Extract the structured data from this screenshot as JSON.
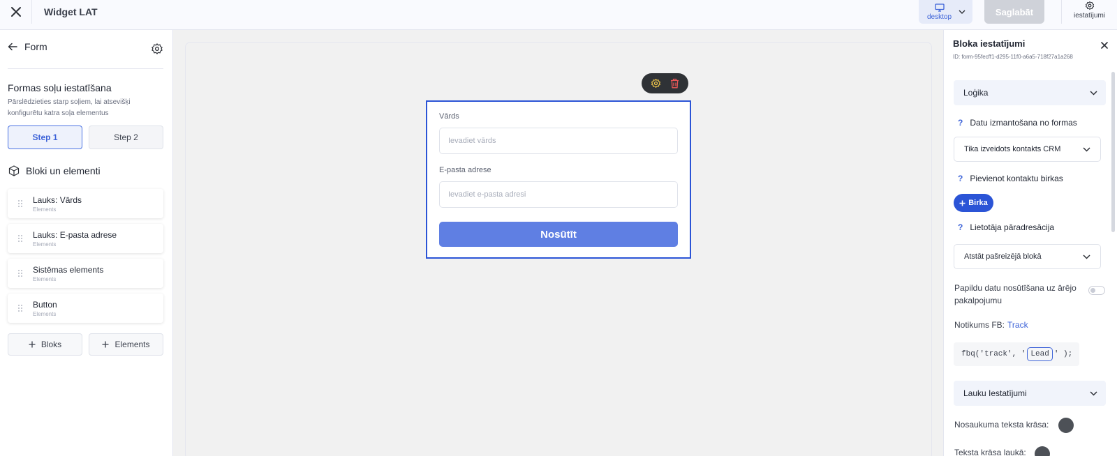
{
  "topbar": {
    "title": "Widget LAT",
    "device_label": "desktop",
    "save_label": "Saglabāt",
    "settings_label": "iestatījumi"
  },
  "left": {
    "back_label": "Form",
    "steps_title": "Formas soļu iestatīšana",
    "steps_desc": "Pārslēdzieties starp soļiem, lai atsevišķi konfigurētu katra soļa elementus",
    "steps": [
      "Step 1",
      "Step 2"
    ],
    "blocks_title": "Bloki un elementi",
    "items": [
      {
        "title": "Lauks: Vārds",
        "sub": "Elements"
      },
      {
        "title": "Lauks: E-pasta adrese",
        "sub": "Elements"
      },
      {
        "title": "Sistēmas elements",
        "sub": "Elements"
      },
      {
        "title": "Button",
        "sub": "Elements"
      }
    ],
    "add_block": "Bloks",
    "add_element": "Elements"
  },
  "form": {
    "name_label": "Vārds",
    "name_placeholder": "Ievadiet vārds",
    "email_label": "E-pasta adrese",
    "email_placeholder": "Ievadiet e-pasta adresi",
    "submit_label": "Nosūtīt"
  },
  "right": {
    "title": "Bloka iestatījumi",
    "id_text": "ID: form-95fecff1-d295-11f0-a6a5-718f27a1a268",
    "logic_label": "Loģika",
    "data_use_label": "Datu izmantošana no formas",
    "data_use_value": "Tika izveidots kontakts CRM",
    "tags_label": "Pievienot kontaktu birkas",
    "tag_button": "Birka",
    "redirect_label": "Lietotāja pāradresācija",
    "redirect_value": "Atstāt pašreizējā blokā",
    "extra_send_label": "Papildu datu nosūtīšana uz ārējo pakalpojumu",
    "extra_send_on": false,
    "fb_label": "Notikums FB:",
    "fb_link": "Track",
    "code_prefix": "fbq('track', '",
    "code_value": "Lead",
    "code_suffix": "' );",
    "field_settings_label": "Lauku Iestatījumi",
    "title_color_label": "Nosaukuma teksta krāsa:",
    "text_color_label": "Teksta krāsa laukā:",
    "title_color": "#4d5157",
    "text_color": "#4d5157"
  },
  "colors": {
    "accent": "#2b54d6",
    "submit": "#5f7fe3"
  }
}
